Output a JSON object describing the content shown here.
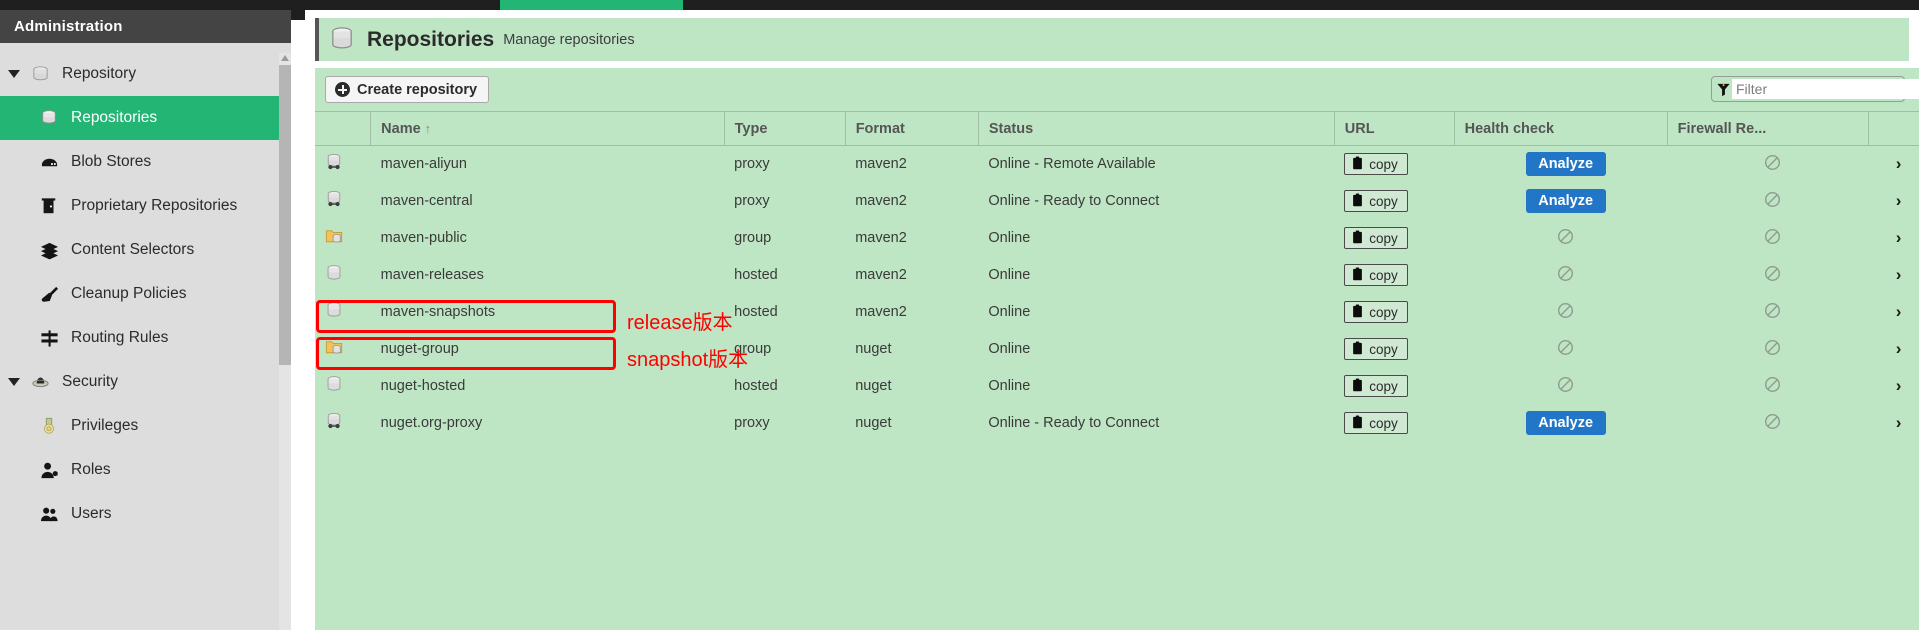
{
  "window": {
    "tab_color": "#22b573",
    "strip_color": "#1f1f1f"
  },
  "sidebar": {
    "header": "Administration",
    "items": [
      {
        "label": "Repository",
        "icon": "database-icon",
        "level": "group",
        "active": false,
        "expanded": true
      },
      {
        "label": "Repositories",
        "icon": "database-icon",
        "level": "child",
        "active": true
      },
      {
        "label": "Blob Stores",
        "icon": "blob-store-icon",
        "level": "child",
        "active": false
      },
      {
        "label": "Proprietary Repositories",
        "icon": "door-icon",
        "level": "child",
        "active": false
      },
      {
        "label": "Content Selectors",
        "icon": "layers-icon",
        "level": "child",
        "active": false
      },
      {
        "label": "Cleanup Policies",
        "icon": "broom-icon",
        "level": "child",
        "active": false
      },
      {
        "label": "Routing Rules",
        "icon": "signpost-icon",
        "level": "child",
        "active": false
      },
      {
        "label": "Security",
        "icon": "shield-icon",
        "level": "group",
        "active": false,
        "expanded": true
      },
      {
        "label": "Privileges",
        "icon": "medal-icon",
        "level": "child",
        "active": false
      },
      {
        "label": "Roles",
        "icon": "user-tag-icon",
        "level": "child",
        "active": false
      },
      {
        "label": "Users",
        "icon": "users-icon",
        "level": "child",
        "active": false
      }
    ]
  },
  "panel": {
    "icon": "database-icon",
    "title": "Repositories",
    "subtitle": "Manage repositories"
  },
  "toolbar": {
    "create_label": "Create repository",
    "create_icon": "plus-circle-icon",
    "filter_icon": "funnel-icon",
    "filter_placeholder": "Filter",
    "filter_value": ""
  },
  "table": {
    "columns": [
      "",
      "Name",
      "Type",
      "Format",
      "Status",
      "URL",
      "Health check",
      "Firewall Re...",
      ""
    ],
    "sort_column": "Name",
    "sort_direction": "↑",
    "copy_label": "copy",
    "analyze_label": "Analyze",
    "rows": [
      {
        "icon": "proxy-repo-icon",
        "name": "maven-aliyun",
        "type": "proxy",
        "format": "maven2",
        "status": "Online - Remote Available",
        "url": "copy",
        "health": "analyze",
        "firewall": "blocked",
        "arrow": "›"
      },
      {
        "icon": "proxy-repo-icon",
        "name": "maven-central",
        "type": "proxy",
        "format": "maven2",
        "status": "Online - Ready to Connect",
        "url": "copy",
        "health": "analyze",
        "firewall": "blocked",
        "arrow": "›"
      },
      {
        "icon": "group-repo-icon",
        "name": "maven-public",
        "type": "group",
        "format": "maven2",
        "status": "Online",
        "url": "copy",
        "health": "blocked",
        "firewall": "blocked",
        "arrow": "›"
      },
      {
        "icon": "hosted-repo-icon",
        "name": "maven-releases",
        "type": "hosted",
        "format": "maven2",
        "status": "Online",
        "url": "copy",
        "health": "blocked",
        "firewall": "blocked",
        "arrow": "›"
      },
      {
        "icon": "hosted-repo-icon",
        "name": "maven-snapshots",
        "type": "hosted",
        "format": "maven2",
        "status": "Online",
        "url": "copy",
        "health": "blocked",
        "firewall": "blocked",
        "arrow": "›"
      },
      {
        "icon": "group-repo-icon",
        "name": "nuget-group",
        "type": "group",
        "format": "nuget",
        "status": "Online",
        "url": "copy",
        "health": "blocked",
        "firewall": "blocked",
        "arrow": "›"
      },
      {
        "icon": "hosted-repo-icon",
        "name": "nuget-hosted",
        "type": "hosted",
        "format": "nuget",
        "status": "Online",
        "url": "copy",
        "health": "blocked",
        "firewall": "blocked",
        "arrow": "›"
      },
      {
        "icon": "proxy-repo-icon",
        "name": "nuget.org-proxy",
        "type": "proxy",
        "format": "nuget",
        "status": "Online - Ready to Connect",
        "url": "copy",
        "health": "analyze",
        "firewall": "blocked",
        "arrow": "›"
      }
    ]
  },
  "annotations": {
    "color": "#ff0000",
    "labels": [
      {
        "text": "release版本"
      },
      {
        "text": "snapshot版本"
      }
    ]
  }
}
